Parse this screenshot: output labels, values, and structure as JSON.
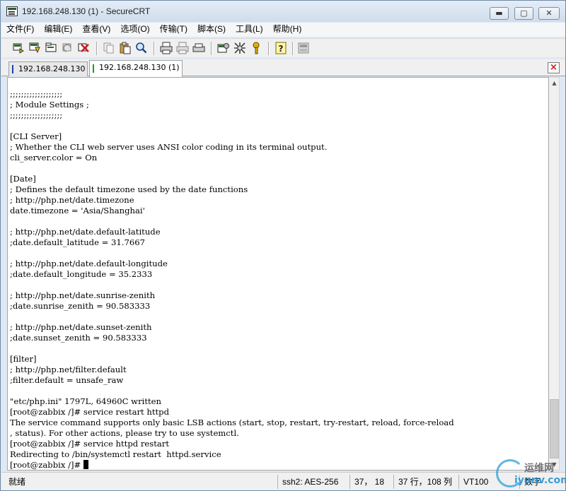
{
  "window": {
    "title": "192.168.248.130 (1) - SecureCRT",
    "icons": {
      "app": "securecrt-app-icon",
      "minimize": "minimize-icon",
      "maximize": "maximize-icon",
      "close": "close-icon"
    },
    "controls": {
      "minimize": "▬",
      "maximize": "▢",
      "close": "✕"
    }
  },
  "menu": [
    "文件(F)",
    "编辑(E)",
    "查看(V)",
    "选项(O)",
    "传输(T)",
    "脚本(S)",
    "工具(L)",
    "帮助(H)"
  ],
  "toolbar": {
    "buttons": [
      "connect-icon",
      "quick-connect-icon",
      "connect-in-tab-icon",
      "reconnect-icon",
      "disconnect-icon",
      "copy-icon",
      "paste-icon",
      "find-icon",
      "print-icon",
      "print-selection-icon",
      "printer-setup-icon",
      "session-options-icon",
      "global-options-icon",
      "keymap-icon",
      "help-icon",
      "sftp-icon"
    ]
  },
  "tabs": [
    {
      "label": "192.168.248.130",
      "active": false
    },
    {
      "label": "192.168.248.130 (1)",
      "active": true
    }
  ],
  "tab_close": "×",
  "terminal": {
    "lines": [
      ";;;;;;;;;;;;;;;;;;;",
      "; Module Settings ;",
      ";;;;;;;;;;;;;;;;;;;",
      "",
      "[CLI Server]",
      "; Whether the CLI web server uses ANSI color coding in its terminal output.",
      "cli_server.color = On",
      "",
      "[Date]",
      "; Defines the default timezone used by the date functions",
      "; http://php.net/date.timezone",
      "date.timezone = 'Asia/Shanghai'",
      "",
      "; http://php.net/date.default-latitude",
      ";date.default_latitude = 31.7667",
      "",
      "; http://php.net/date.default-longitude",
      ";date.default_longitude = 35.2333",
      "",
      "; http://php.net/date.sunrise-zenith",
      ";date.sunrise_zenith = 90.583333",
      "",
      "; http://php.net/date.sunset-zenith",
      ";date.sunset_zenith = 90.583333",
      "",
      "[filter]",
      "; http://php.net/filter.default",
      ";filter.default = unsafe_raw",
      "",
      "\"etc/php.ini\" 1797L, 64960C written",
      "[root@zabbix /]# service restart httpd",
      "The service command supports only basic LSB actions (start, stop, restart, try-restart, reload, force-reload",
      ", status). For other actions, please try to use systemctl.",
      "[root@zabbix /]# service httpd restart",
      "Redirecting to /bin/systemctl restart  httpd.service",
      "[root@zabbix /]# "
    ]
  },
  "scrollbar": {
    "up": "▲",
    "down": "▼",
    "position": 0.82
  },
  "status": {
    "ready": "就绪",
    "cipher": "ssh2: AES-256",
    "cursor": "37，  18",
    "size": "37 行，108 列",
    "terminal_type": "VT100",
    "num": "数字"
  },
  "watermark": {
    "top": "运维网",
    "bottom": "iyunv.com"
  }
}
